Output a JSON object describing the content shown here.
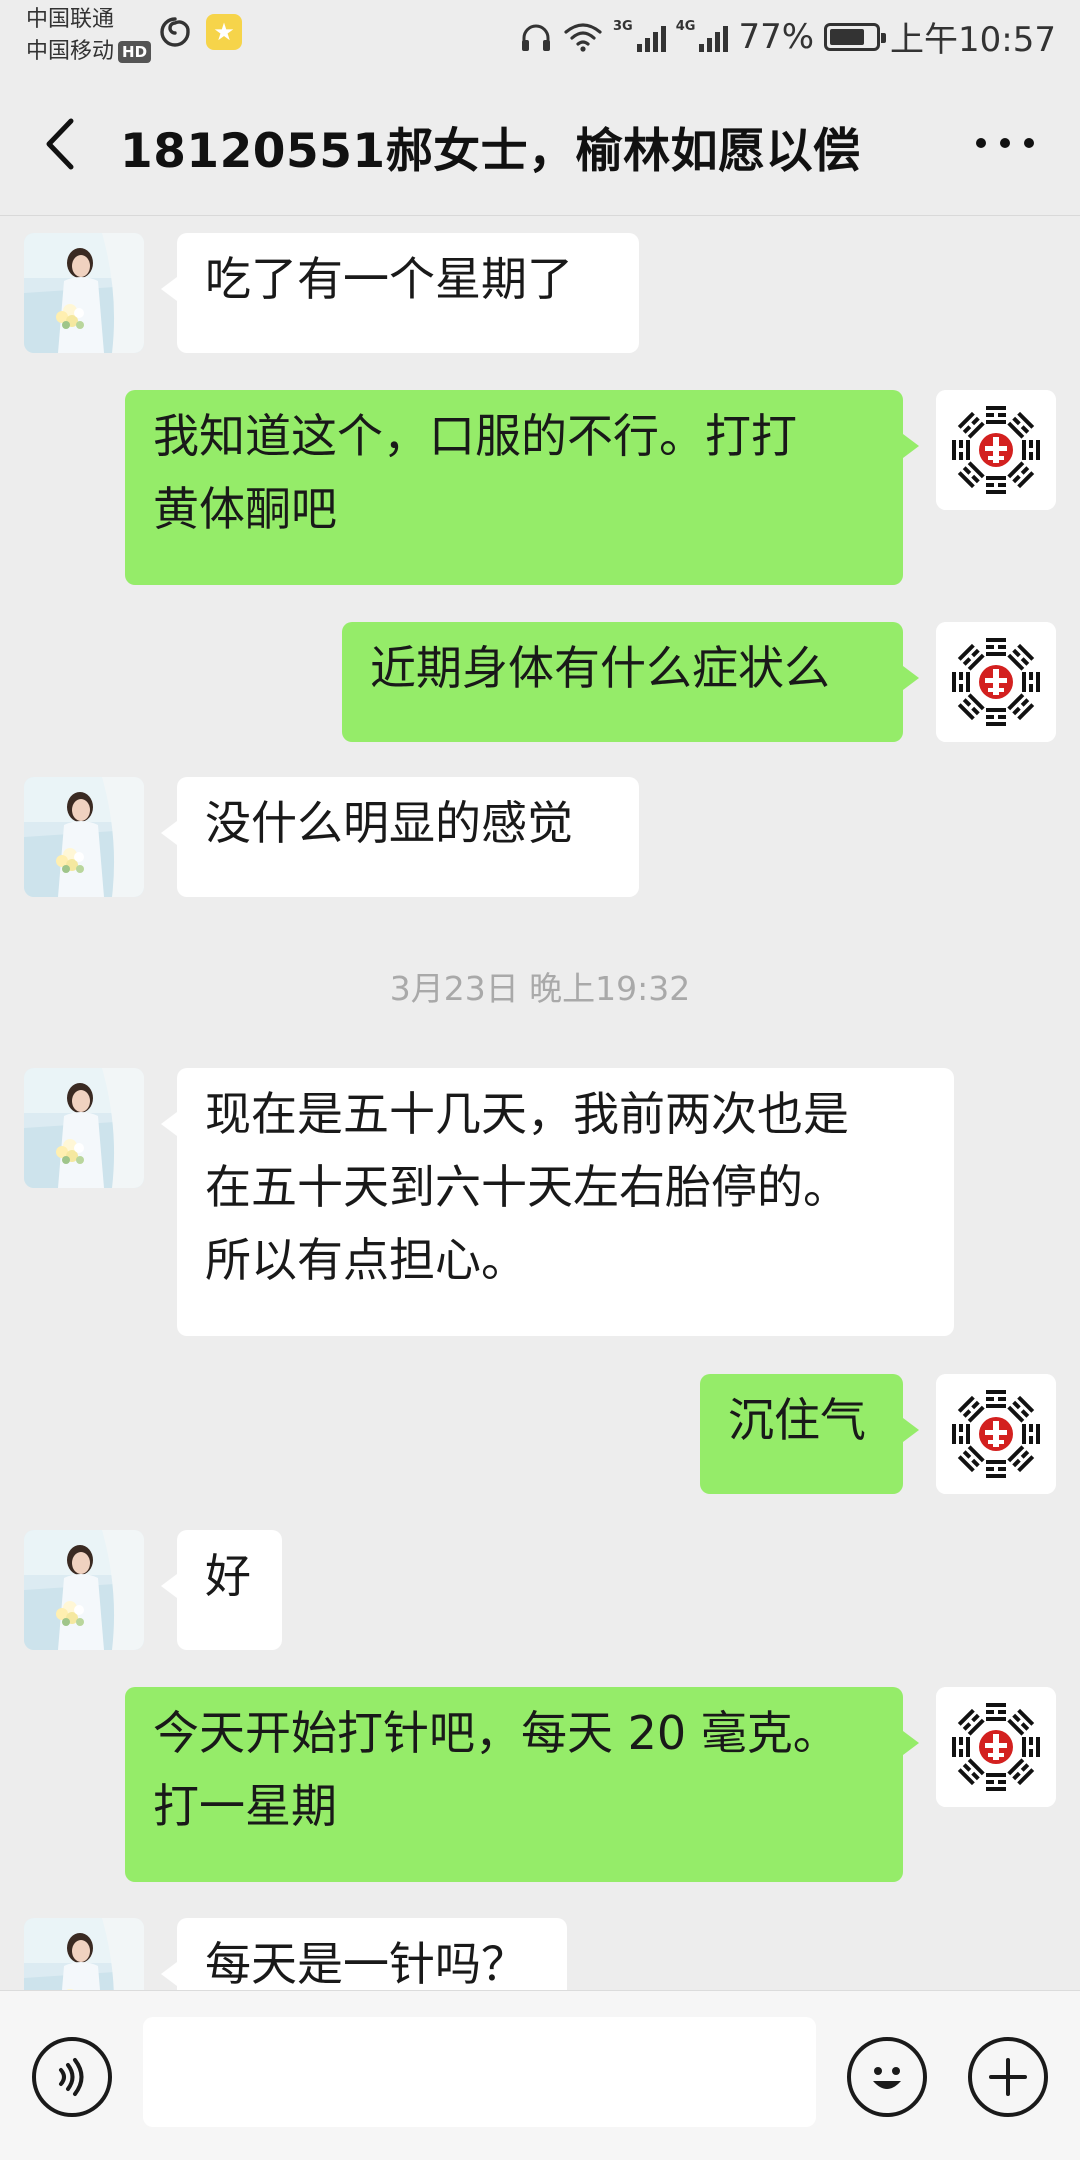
{
  "status_bar": {
    "carrier_1": "中国联通",
    "carrier_2": "中国移动",
    "hd_badge": "HD",
    "net_1": "3G",
    "net_2": "4G",
    "battery_text": "77%",
    "battery_level": 0.77,
    "time": "上午10:57"
  },
  "header": {
    "title": "18120551郝女士，榆林如愿以偿"
  },
  "messages": [
    {
      "side": "left",
      "text": "吃了有一个星期了"
    },
    {
      "side": "right",
      "text": "我知道这个，口服的不行。打打\n黄体酮吧"
    },
    {
      "side": "right",
      "text": "近期身体有什么症状么"
    },
    {
      "side": "left",
      "text": "没什么明显的感觉"
    },
    {
      "side": "left",
      "text": "现在是五十几天，我前两次也是\n在五十天到六十天左右胎停的。\n所以有点担心。"
    },
    {
      "side": "right",
      "text": "沉住气"
    },
    {
      "side": "left",
      "text": "好"
    },
    {
      "side": "right",
      "text": "今天开始打针吧，每天 20 毫克。\n打一星期"
    },
    {
      "side": "left",
      "text": "每天是一针吗？"
    }
  ],
  "timestamp": "3月23日 晚上19:32",
  "input_bar": {
    "voice_icon": "voice-icon",
    "emoji_icon": "emoji-icon",
    "plus_icon": "plus-icon"
  },
  "colors": {
    "background": "#ededed",
    "bubble_self": "#95ec69",
    "bubble_other": "#ffffff"
  }
}
